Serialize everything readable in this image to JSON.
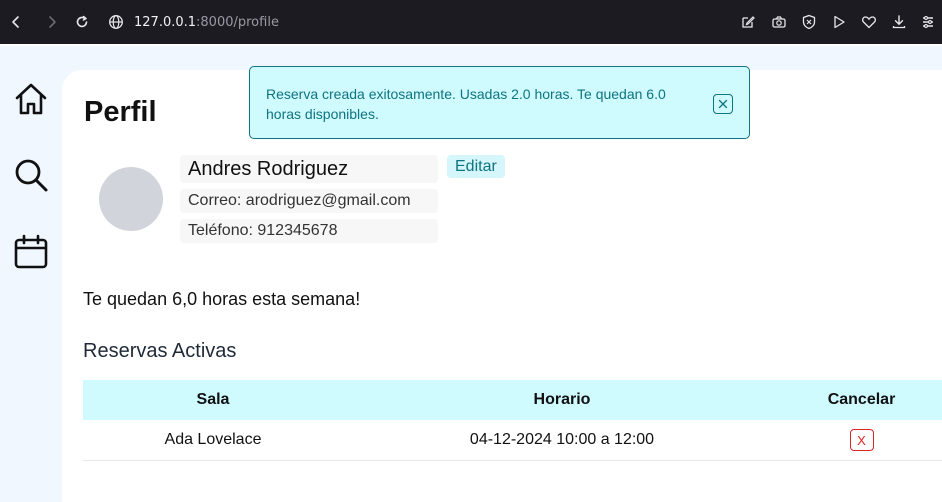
{
  "browser": {
    "url_host": "127.0.0.1",
    "url_path": ":8000/profile"
  },
  "sidebar": {
    "items": [
      {
        "icon": "home-icon"
      },
      {
        "icon": "search-icon"
      },
      {
        "icon": "calendar-icon"
      }
    ]
  },
  "toast": {
    "message": "Reserva creada exitosamente. Usadas 2.0 horas. Te quedan 6.0 horas disponibles.",
    "close_label": "×"
  },
  "profile": {
    "title": "Perfil",
    "name": "Andres Rodriguez",
    "email": "Correo: arodriguez@gmail.com",
    "phone": "Teléfono: 912345678",
    "edit_label": "Editar"
  },
  "hours_message": "Te quedan 6,0 horas esta semana!",
  "reservations": {
    "title": "Reservas Activas",
    "columns": [
      "Sala",
      "Horario",
      "Cancelar"
    ],
    "rows": [
      {
        "room": "Ada Lovelace",
        "schedule": "04-12-2024 10:00 a 12:00",
        "cancel_label": "X"
      }
    ]
  },
  "colors": {
    "accent": "#0e7480",
    "toast_bg": "#cffafe",
    "danger": "#dc2626"
  }
}
